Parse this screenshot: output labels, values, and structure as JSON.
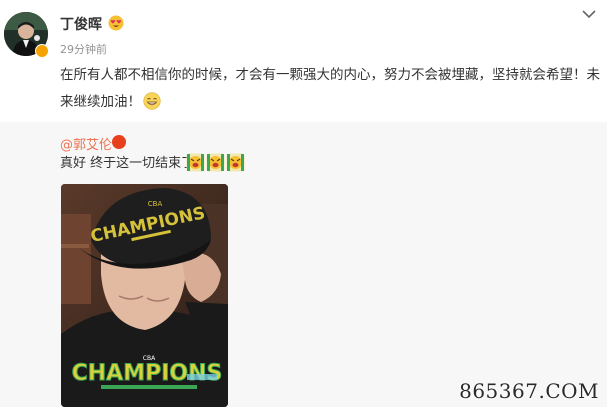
{
  "post": {
    "author": "丁俊晖",
    "time": "29分钟前",
    "text": "在所有人都不相信你的时候，才会有一颗强大的内心，努力不会被埋藏，坚持就会希望！未来继续加油！",
    "name_emoji": "heart-eyes-emoji",
    "text_emoji": "grin-emoji"
  },
  "retweet": {
    "author": "@郭艾伦",
    "text": "真好  终于这一切结束了",
    "emojis": [
      "trophy-emoji",
      "trophy-emoji",
      "trophy-emoji"
    ],
    "photo_caption_cap": "CHAMPIONS",
    "photo_caption_cap_top": "CBA"
  },
  "watermark": "865367.COM",
  "colors": {
    "link": "#eb7350",
    "retweet_bg": "#f7f7f7",
    "verified_gold": "#f4a300",
    "verified_red": "#e8401c"
  }
}
